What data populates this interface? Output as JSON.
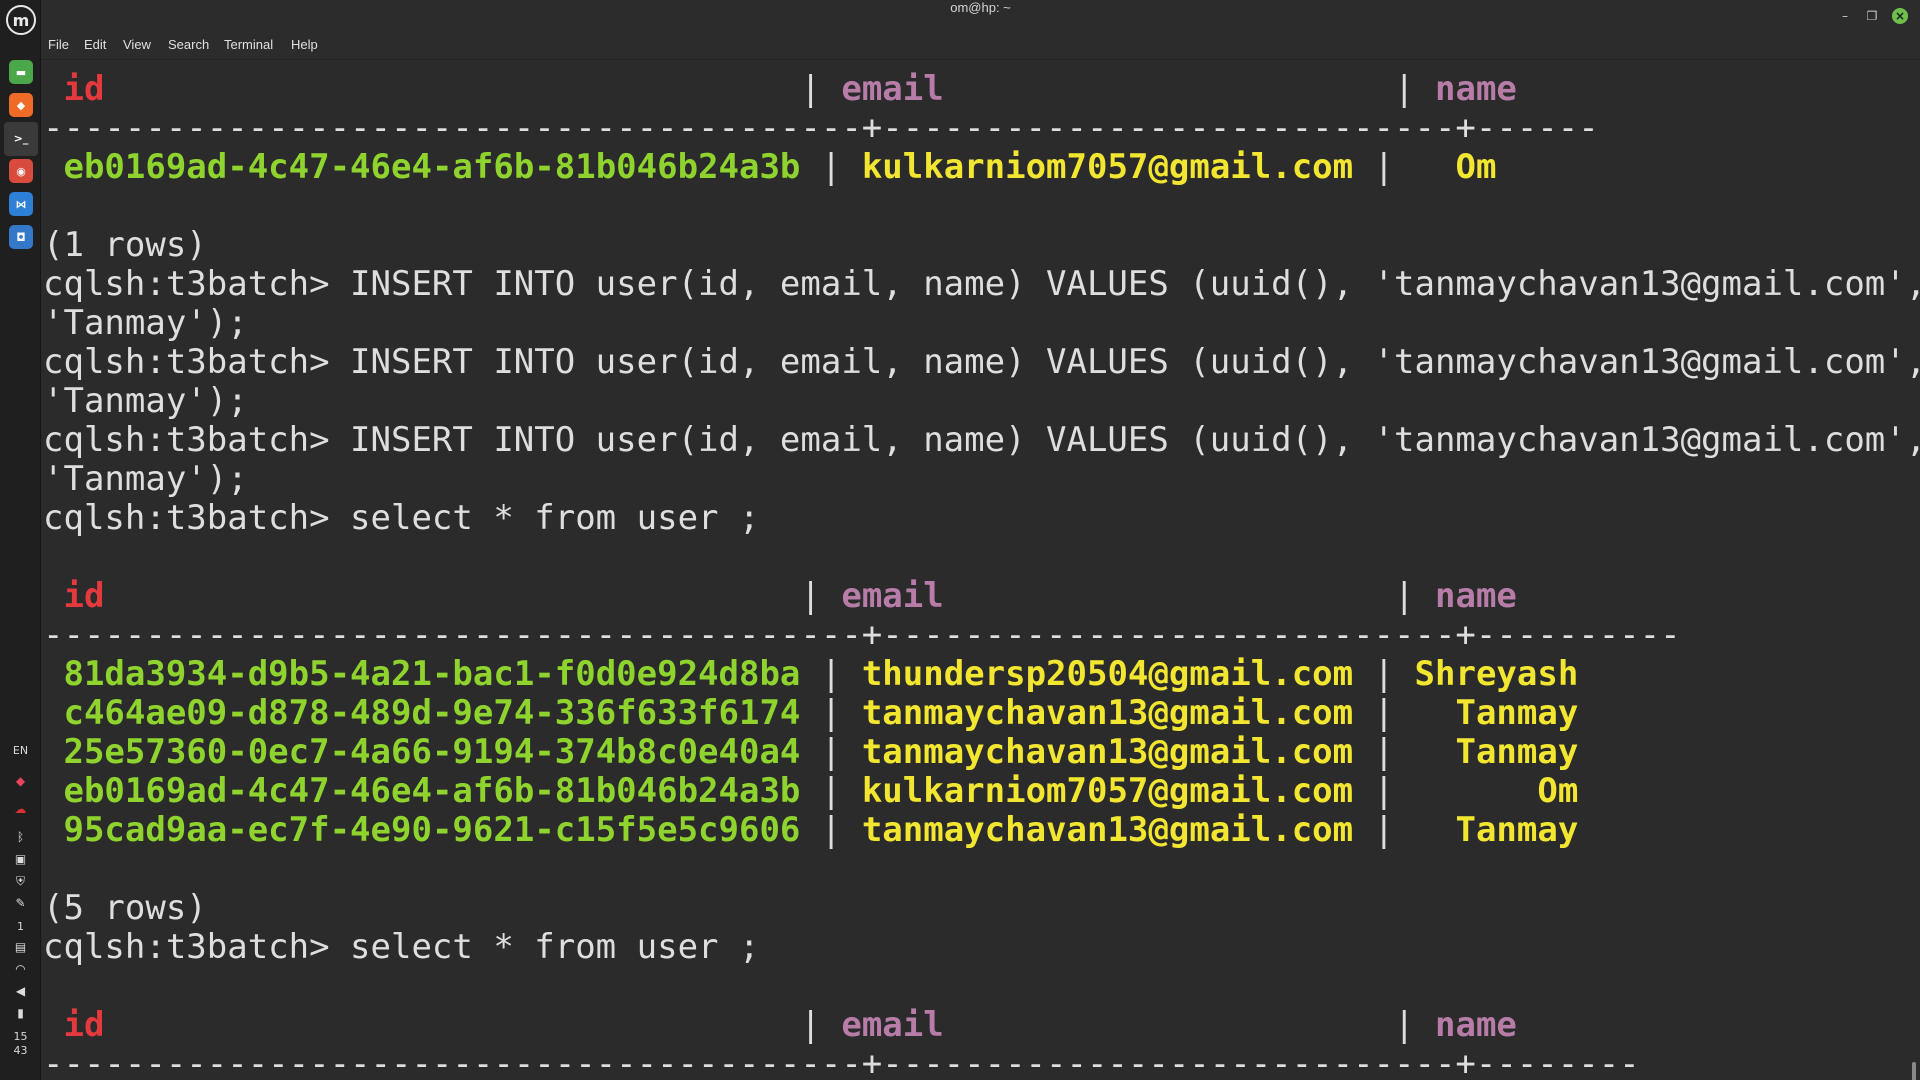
{
  "window": {
    "title": "om@hp: ~"
  },
  "menu": [
    "File",
    "Edit",
    "View",
    "Search",
    "Terminal",
    "Help"
  ],
  "dock": {
    "logo": "m",
    "apps": [
      {
        "name": "files-icon",
        "color": "#4aa84a",
        "glyph": "▬"
      },
      {
        "name": "brave-icon",
        "color": "#f06a28",
        "glyph": "◆"
      },
      {
        "name": "terminal-icon",
        "color": "#3a3a3a",
        "glyph": ">_"
      },
      {
        "name": "chrome-icon",
        "color": "#d94b3c",
        "glyph": "◉"
      },
      {
        "name": "vscode-icon",
        "color": "#2e7fd6",
        "glyph": "⋈"
      },
      {
        "name": "camera-icon",
        "color": "#3478c8",
        "glyph": "◘"
      }
    ],
    "tray": {
      "lang": "EN",
      "workspace": "1",
      "clock_hour": "15",
      "clock_min": "43"
    }
  },
  "terminal": {
    "col_headers": {
      "id": "id",
      "email": "email",
      "name": "name"
    },
    "table1": {
      "divider": "----------------------------------------+----------------------------+------",
      "rows": [
        {
          "id": "eb0169ad-4c47-46e4-af6b-81b046b24a3b",
          "email": "kulkarniom7057@gmail.com",
          "name": "  Om"
        }
      ],
      "footer": "(1 rows)"
    },
    "commands": [
      {
        "prompt": "cqlsh:t3batch> ",
        "cmd": "INSERT INTO user(id, email, name) VALUES (uuid(), 'tanmaychavan13@gmail.com',",
        "cont": "'Tanmay');"
      },
      {
        "prompt": "cqlsh:t3batch> ",
        "cmd": "INSERT INTO user(id, email, name) VALUES (uuid(), 'tanmaychavan13@gmail.com',",
        "cont": "'Tanmay');"
      },
      {
        "prompt": "cqlsh:t3batch> ",
        "cmd": "INSERT INTO user(id, email, name) VALUES (uuid(), 'tanmaychavan13@gmail.com',",
        "cont": "'Tanmay');"
      }
    ],
    "select1": {
      "prompt": "cqlsh:t3batch> ",
      "cmd": "select * from user ;"
    },
    "table2": {
      "divider": "----------------------------------------+----------------------------+----------",
      "rows": [
        {
          "id": "81da3934-d9b5-4a21-bac1-f0d0e924d8ba",
          "email": "thundersp20504@gmail.com",
          "name": "Shreyash"
        },
        {
          "id": "c464ae09-d878-489d-9e74-336f633f6174",
          "email": "tanmaychavan13@gmail.com",
          "name": "  Tanmay"
        },
        {
          "id": "25e57360-0ec7-4a66-9194-374b8c0e40a4",
          "email": "tanmaychavan13@gmail.com",
          "name": "  Tanmay"
        },
        {
          "id": "eb0169ad-4c47-46e4-af6b-81b046b24a3b",
          "email": "kulkarniom7057@gmail.com",
          "name": "      Om"
        },
        {
          "id": "95cad9aa-ec7f-4e90-9621-c15f5e5c9606",
          "email": "tanmaychavan13@gmail.com",
          "name": "  Tanmay"
        }
      ],
      "footer": "(5 rows)"
    },
    "select2": {
      "prompt": "cqlsh:t3batch> ",
      "cmd": "select * from user ;"
    },
    "table3": {
      "divider": "----------------------------------------+----------------------------+--------"
    }
  }
}
